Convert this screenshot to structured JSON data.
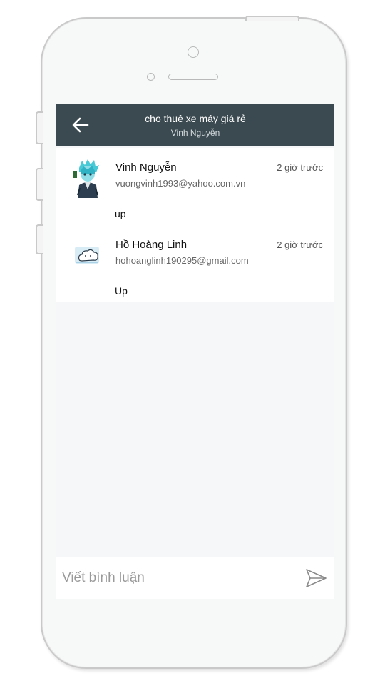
{
  "header": {
    "title": "cho thuê xe máy giá rẻ",
    "subtitle": "Vinh Nguyễn",
    "back_icon": "arrow-left-icon"
  },
  "comments": [
    {
      "name": "Vinh Nguyễn",
      "email": "vuongvinh1993@yahoo.com.vn",
      "time": "2 giờ trước",
      "text": "up",
      "avatar": "anime-character-avatar"
    },
    {
      "name": "Hồ Hoàng Linh",
      "email": "hohoanglinh190295@gmail.com",
      "time": "2 giờ trước",
      "text": "Up",
      "avatar": "cloud-sticker-avatar"
    }
  ],
  "composer": {
    "placeholder": "Viết bình luận",
    "value": "",
    "send_icon": "send-icon"
  },
  "colors": {
    "header_bg": "#3b4a50",
    "screen_bg": "#f6f7f8"
  }
}
